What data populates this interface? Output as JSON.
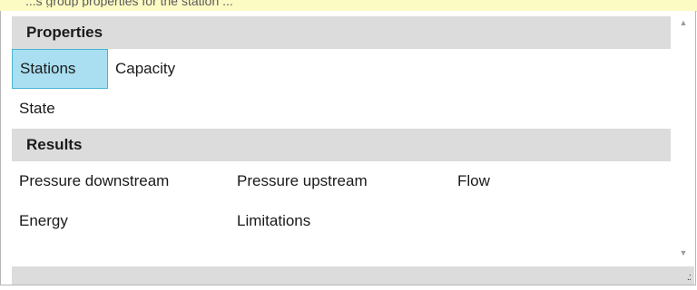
{
  "top_strip": {
    "text": "...s group properties for the station ..."
  },
  "properties": {
    "header": "Properties",
    "rows": [
      [
        {
          "label": "Stations",
          "selected": true
        },
        {
          "label": "Capacity"
        }
      ],
      [
        {
          "label": "State"
        }
      ]
    ]
  },
  "results": {
    "header": "Results",
    "rows": [
      [
        {
          "label": "Pressure downstream"
        },
        {
          "label": "Pressure upstream"
        },
        {
          "label": "Flow"
        }
      ],
      [
        {
          "label": "Energy"
        },
        {
          "label": "Limitations"
        }
      ]
    ]
  },
  "scrollbar": {
    "up_icon": "triangle-up",
    "down_icon": "triangle-down"
  },
  "resize_grip": {
    "glyph": ".:"
  },
  "colors": {
    "selected_background": "#a9dff0",
    "selected_border": "#48b3d2",
    "header_background": "#dcdcdc",
    "top_strip": "#fdfbc4"
  }
}
